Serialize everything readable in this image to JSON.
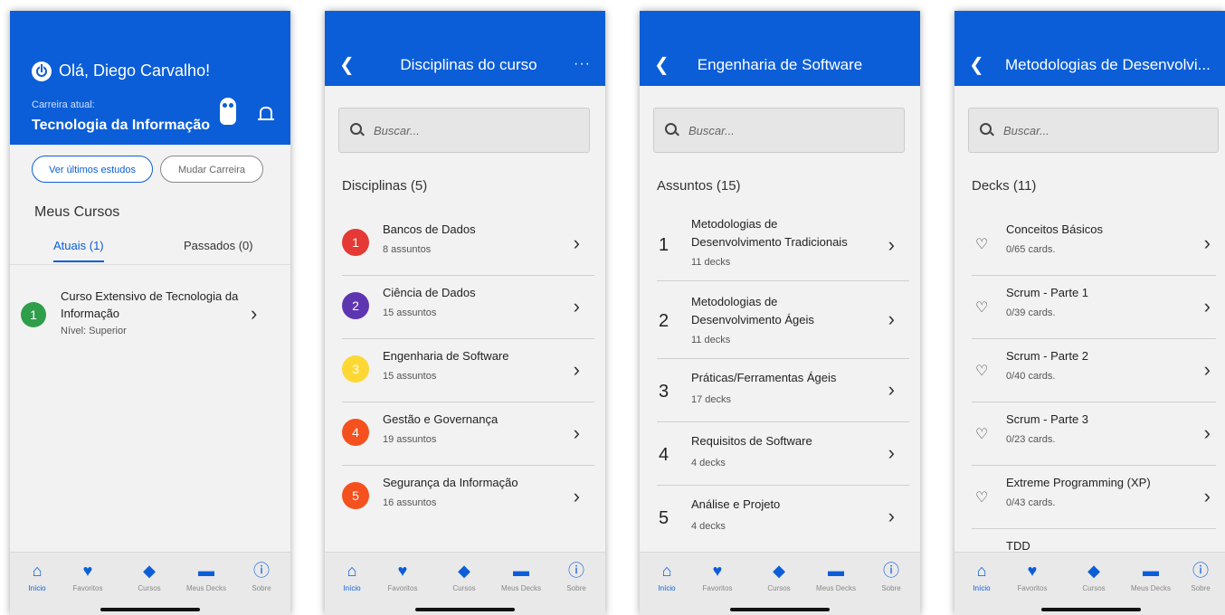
{
  "screen1": {
    "greeting": "Olá, Diego Carvalho!",
    "career_label": "Carreira atual:",
    "career": "Tecnologia da Informação",
    "btn_recent": "Ver últimos estudos",
    "btn_change": "Mudar Carreira",
    "section": "Meus Cursos",
    "tab_current": "Atuais (1)",
    "tab_past": "Passados (0)",
    "course": {
      "num": "1",
      "title": "Curso Extensivo de Tecnologia da Informação",
      "level": "Nível: Superior"
    }
  },
  "screen2": {
    "title": "Disciplinas do curso",
    "more": "···",
    "search_placeholder": "Buscar...",
    "section": "Disciplinas (5)",
    "items": [
      {
        "num": "1",
        "title": "Bancos de Dados",
        "sub": "8 assuntos",
        "color": "#e53935"
      },
      {
        "num": "2",
        "title": "Ciência de Dados",
        "sub": "15 assuntos",
        "color": "#5e35b1"
      },
      {
        "num": "3",
        "title": "Engenharia de Software",
        "sub": "15 assuntos",
        "color": "#fdd835"
      },
      {
        "num": "4",
        "title": "Gestão e Governança",
        "sub": "19 assuntos",
        "color": "#f4511e"
      },
      {
        "num": "5",
        "title": "Segurança da Informação",
        "sub": "16 assuntos",
        "color": "#f4511e"
      }
    ]
  },
  "screen3": {
    "title": "Engenharia de Software",
    "search_placeholder": "Buscar...",
    "section": "Assuntos (15)",
    "items": [
      {
        "num": "1",
        "title": "Metodologias de Desenvolvimento Tradicionais",
        "sub": "11 decks"
      },
      {
        "num": "2",
        "title": "Metodologias de Desenvolvimento Ágeis",
        "sub": "11 decks"
      },
      {
        "num": "3",
        "title": "Práticas/Ferramentas Ágeis",
        "sub": "17 decks"
      },
      {
        "num": "4",
        "title": "Requisitos de Software",
        "sub": "4 decks"
      },
      {
        "num": "5",
        "title": "Análise e Projeto",
        "sub": "4 decks"
      }
    ]
  },
  "screen4": {
    "title": "Metodologias de Desenvolvi...",
    "search_placeholder": "Buscar...",
    "section": "Decks (11)",
    "items": [
      {
        "title": "Conceitos Básicos",
        "sub": "0/65 cards."
      },
      {
        "title": "Scrum - Parte 1",
        "sub": "0/39 cards."
      },
      {
        "title": "Scrum - Parte 2",
        "sub": "0/40 cards."
      },
      {
        "title": "Scrum - Parte 3",
        "sub": "0/23 cards."
      },
      {
        "title": "Extreme Programming (XP)",
        "sub": "0/43 cards."
      },
      {
        "title": "TDD",
        "sub": ""
      }
    ]
  },
  "nav": {
    "home": "Início",
    "favorites": "Favoritos",
    "courses": "Cursos",
    "decks": "Meus Decks",
    "about": "Sobre"
  },
  "colors": {
    "primary": "#0b5ed7",
    "course_green": "#2e9e4a"
  }
}
